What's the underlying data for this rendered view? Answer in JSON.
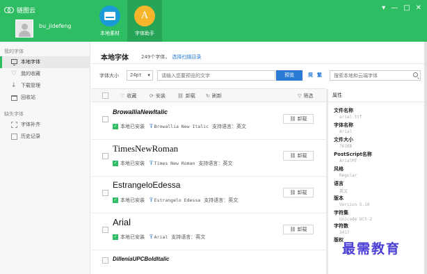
{
  "app": {
    "name": "链图云"
  },
  "user": {
    "name": "bu_jidefeng"
  },
  "tools": [
    {
      "label": "本地素材"
    },
    {
      "label": "字体助手",
      "icon_text": "A"
    }
  ],
  "window_controls": {
    "menu": "▾",
    "minimize": "—",
    "maximize": "□",
    "close": "✕"
  },
  "sidebar": {
    "my_fonts_heading": "我的字体",
    "my_fonts": [
      {
        "label": "本地字体",
        "icon": "monitor-icon",
        "active": true
      },
      {
        "label": "我的收藏",
        "icon": "heart-icon"
      },
      {
        "label": "下载管理",
        "icon": "download-icon"
      },
      {
        "label": "回收站",
        "icon": "trash-icon"
      }
    ],
    "missing_heading": "缺失字体",
    "missing": [
      {
        "label": "字体补齐",
        "icon": "font-complete-icon"
      },
      {
        "label": "历史记录",
        "icon": "history-icon"
      }
    ]
  },
  "main": {
    "title": "本地字体",
    "count_text": "249个字体，",
    "scan_link": "选择扫描目录",
    "size_label": "字体大小",
    "size_value": "24pt",
    "preview_placeholder": "请输入您要预览的文字",
    "preview_button": "预览",
    "simp": "简",
    "trad": "繁",
    "search_placeholder": "搜索本地和云端字体",
    "actions": {
      "favorite": "收藏",
      "install": "安装",
      "uninstall": "卸载",
      "refresh": "刷新",
      "filter": "筛选"
    },
    "fonts": [
      {
        "name": "BrowalliaNewItalic",
        "status": "本地已安装",
        "sample": "Browallia New Italic",
        "lang": "支持语言：英文",
        "button": "卸载"
      },
      {
        "name": "TimesNewRoman",
        "status": "本地已安装",
        "sample": "Times New Roman",
        "lang": "支持语言：英文",
        "button": "卸载"
      },
      {
        "name": "EstrangeloEdessa",
        "status": "本地已安装",
        "sample": "Estrangelo Edessa",
        "lang": "支持语言：英文",
        "button": "卸载"
      },
      {
        "name": "Arial",
        "status": "本地已安装",
        "sample": "Arial",
        "lang": "支持语言：英文",
        "button": "卸载"
      },
      {
        "name": "DilleniaUPCBoldItalic"
      }
    ]
  },
  "properties": {
    "heading": "属性",
    "items": [
      {
        "key": "文件名称",
        "value": "arial.ttf"
      },
      {
        "key": "字体名称",
        "value": "Arial"
      },
      {
        "key": "文件大小",
        "value": "761KB"
      },
      {
        "key": "PostScript名称",
        "value": "ArialMT"
      },
      {
        "key": "风格",
        "value": "Regular"
      },
      {
        "key": "语言",
        "value": "英文"
      },
      {
        "key": "版本",
        "value": "Version 5.10"
      },
      {
        "key": "字符集",
        "value": "Unicode UCS-2"
      },
      {
        "key": "字符数",
        "value": "3417"
      },
      {
        "key": "版权",
        "value": ""
      }
    ]
  },
  "watermark": "最需教育"
}
